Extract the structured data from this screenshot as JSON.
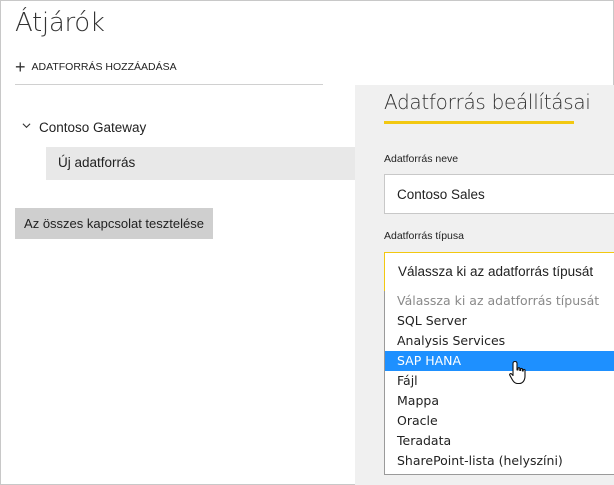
{
  "page": {
    "title": "Átjárók",
    "add_label": "ADATFORRÁS HOZZÁADÁSA"
  },
  "tree": {
    "gateway_label": "Contoso Gateway",
    "source_label": "Új adatforrás"
  },
  "test_button_label": "Az összes kapcsolat tesztelése",
  "settings": {
    "title": "Adatforrás beállításai",
    "name_label": "Adatforrás neve",
    "name_value": "Contoso Sales",
    "type_label": "Adatforrás típusa",
    "type_value": "Válassza ki az adatforrás típusát",
    "options": [
      "Válassza ki az adatforrás típusát",
      "SQL Server",
      "Analysis Services",
      "SAP HANA",
      "Fájl",
      "Mappa",
      "Oracle",
      "Teradata",
      "SharePoint-lista (helyszíni)"
    ],
    "highlighted_option": "SAP HANA"
  },
  "colors": {
    "accent": "#f2c811",
    "selection": "#1e90ff",
    "panel_bg": "#f0f0f0"
  },
  "icons": [
    "plus-icon",
    "chevron-down-icon",
    "hand-cursor-icon"
  ]
}
